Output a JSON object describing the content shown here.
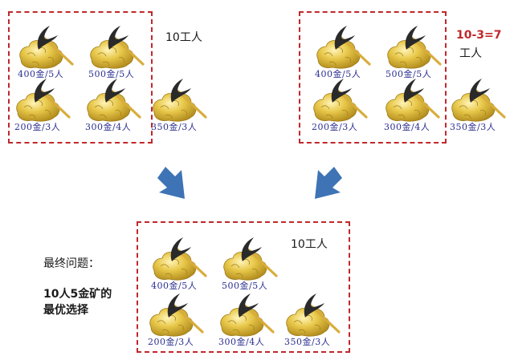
{
  "top_left": {
    "workers": "10工人",
    "mines": [
      "400金/5人",
      "500金/5人",
      "200金/3人",
      "300金/4人",
      "350金/3人"
    ]
  },
  "top_right": {
    "formula": "10-3=7",
    "workers": "工人",
    "mines": [
      "400金/5人",
      "500金/5人",
      "200金/3人",
      "300金/4人",
      "350金/3人"
    ]
  },
  "bottom": {
    "workers": "10工人",
    "mines": [
      "400金/5人",
      "500金/5人",
      "200金/3人",
      "300金/4人",
      "350金/3人"
    ]
  },
  "question": {
    "heading": "最终问题：",
    "line1": "10人5金矿的",
    "line2": "最优选择"
  },
  "colors": {
    "border": "#c0282b",
    "arrow": "#3e73b5",
    "gold": "#e8c84a",
    "caption": "#2b2f8f"
  },
  "icons": [
    "gold-mine-icon",
    "pickaxe-icon",
    "arrow-down-icon"
  ]
}
